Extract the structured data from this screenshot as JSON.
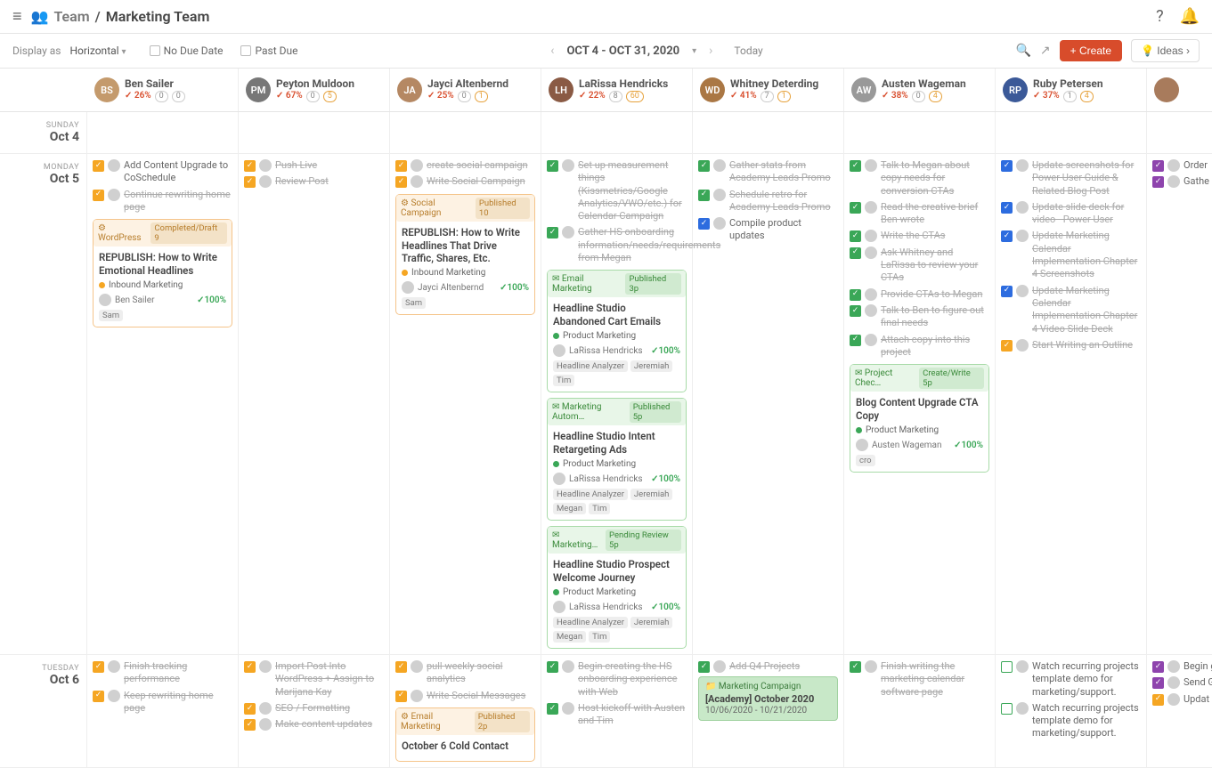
{
  "header": {
    "team_label": "Team",
    "breadcrumb_sep": "/",
    "page_title": "Marketing Team"
  },
  "toolbar": {
    "display_as_label": "Display as",
    "display_as_value": "Horizontal",
    "no_due_date": "No Due Date",
    "past_due": "Past Due",
    "date_range": "OCT 4 - OCT 31, 2020",
    "today": "Today",
    "create": "Create",
    "ideas": "Ideas"
  },
  "people": [
    {
      "name": "Ben Sailer",
      "percent": "26%",
      "n1": "0",
      "n2": "0",
      "initials": "BS",
      "avatar_bg": "#c49a6c"
    },
    {
      "name": "Peyton Muldoon",
      "percent": "67%",
      "n1": "0",
      "n2": "5",
      "initials": "PM",
      "avatar_bg": "#777"
    },
    {
      "name": "Jayci Altenbernd",
      "percent": "25%",
      "n1": "0",
      "n2": "1",
      "initials": "JA",
      "avatar_bg": "#b58863"
    },
    {
      "name": "LaRissa Hendricks",
      "percent": "22%",
      "n1": "8",
      "n2": "60",
      "initials": "LH",
      "avatar_bg": "#8a5a44"
    },
    {
      "name": "Whitney Deterding",
      "percent": "41%",
      "n1": "7",
      "n2": "1",
      "initials": "WD",
      "avatar_bg": "#aa7744"
    },
    {
      "name": "Austen Wageman",
      "percent": "38%",
      "n1": "0",
      "n2": "4",
      "initials": "AW",
      "avatar_bg": "#999"
    },
    {
      "name": "Ruby Petersen",
      "percent": "37%",
      "n1": "1",
      "n2": "4",
      "initials": "RP",
      "avatar_bg": "#3b5998"
    },
    {
      "name": "",
      "percent": "",
      "n1": "",
      "n2": "",
      "initials": "",
      "avatar_bg": "#a87b5c"
    }
  ],
  "days": [
    {
      "dow": "SUNDAY",
      "label": "Oct 4",
      "cells": [
        [],
        [],
        [],
        [],
        [],
        [],
        [],
        []
      ]
    },
    {
      "dow": "MONDAY",
      "label": "Oct 5",
      "cells": [
        [
          {
            "type": "task",
            "chk": "orange",
            "text": "Add Content Upgrade to CoSchedule"
          },
          {
            "type": "task",
            "chk": "orange",
            "text": "Continue rewriting home page",
            "strike": true
          },
          {
            "type": "card",
            "color": "orange",
            "head_left": "WordPress",
            "head_right": "Completed/Draft 9",
            "title": "REPUBLISH: How to Write Emotional Headlines",
            "sub": "Inbound Marketing",
            "subdot": "orange",
            "person": "Ben Sailer",
            "pct": "100%",
            "chips": [
              "Sam"
            ]
          }
        ],
        [
          {
            "type": "task",
            "chk": "orange",
            "text": "Push Live",
            "strike": true
          },
          {
            "type": "task",
            "chk": "orange",
            "text": "Review Post",
            "strike": true
          }
        ],
        [
          {
            "type": "task",
            "chk": "orange",
            "text": "create social campaign",
            "strike": true
          },
          {
            "type": "task",
            "chk": "orange",
            "text": "Write Social Campaign",
            "strike": true
          },
          {
            "type": "card",
            "color": "orange",
            "head_left": "Social Campaign",
            "head_right": "Published 10",
            "title": "REPUBLISH: How to Write Headlines That Drive Traffic, Shares, Etc.",
            "sub": "Inbound Marketing",
            "subdot": "orange",
            "person": "Jayci Altenbernd",
            "pct": "100%",
            "chips": [
              "Sam"
            ]
          }
        ],
        [
          {
            "type": "task",
            "chk": "green",
            "text": "Set up measurement things (Kissmetrics/Google Analytics/VWO/etc.) for Calendar Campaign",
            "strike": true
          },
          {
            "type": "task",
            "chk": "green",
            "text": "Gather HS onboarding information/needs/requirements from Megan",
            "strike": true
          },
          {
            "type": "card",
            "color": "green",
            "head_left": "Email Marketing",
            "head_right": "Published 3p",
            "title": "Headline Studio Abandoned Cart Emails",
            "sub": "Product Marketing",
            "subdot": "green",
            "person": "LaRissa Hendricks",
            "pct": "100%",
            "chips": [
              "Headline Analyzer",
              "Jeremiah",
              "Tim"
            ]
          },
          {
            "type": "card",
            "color": "green",
            "head_left": "Marketing Autom…",
            "head_right": "Published 5p",
            "title": "Headline Studio Intent Retargeting Ads",
            "sub": "Product Marketing",
            "subdot": "green",
            "person": "LaRissa Hendricks",
            "pct": "100%",
            "chips": [
              "Headline Analyzer",
              "Jeremiah",
              "Megan",
              "Tim"
            ]
          },
          {
            "type": "card",
            "color": "green",
            "head_left": "Marketing…",
            "head_right": "Pending Review 5p",
            "title": "Headline Studio Prospect Welcome Journey",
            "sub": "Product Marketing",
            "subdot": "green",
            "person": "LaRissa Hendricks",
            "pct": "100%",
            "chips": [
              "Headline Analyzer",
              "Jeremiah",
              "Megan",
              "Tim"
            ]
          }
        ],
        [
          {
            "type": "task",
            "chk": "green",
            "text": "Gather stats from Academy Leads Promo",
            "strike": true
          },
          {
            "type": "task",
            "chk": "green",
            "text": "Schedule retro for Academy Leads Promo",
            "strike": true
          },
          {
            "type": "task",
            "chk": "blue",
            "text": "Compile product updates"
          }
        ],
        [
          {
            "type": "task",
            "chk": "green",
            "text": "Talk to Megan about copy needs for conversion CTAs",
            "strike": true
          },
          {
            "type": "task",
            "chk": "green",
            "text": "Read the creative brief Ben wrote",
            "strike": true
          },
          {
            "type": "task",
            "chk": "green",
            "text": "Write the CTAs",
            "strike": true
          },
          {
            "type": "task",
            "chk": "green",
            "text": "Ask Whitney and LaRissa to review your CTAs",
            "strike": true
          },
          {
            "type": "task",
            "chk": "green",
            "text": "Provide CTAs to Megan",
            "strike": true
          },
          {
            "type": "task",
            "chk": "green",
            "text": "Talk to Ben to figure out final needs",
            "strike": true
          },
          {
            "type": "task",
            "chk": "green",
            "text": "Attach copy into this project",
            "strike": true
          },
          {
            "type": "card",
            "color": "green",
            "head_left": "Project Chec…",
            "head_right": "Create/Write 5p",
            "title": "Blog Content Upgrade CTA Copy",
            "sub": "Product Marketing",
            "subdot": "green",
            "person": "Austen Wageman",
            "pct": "100%",
            "chips": [
              "cro"
            ]
          }
        ],
        [
          {
            "type": "task",
            "chk": "blue",
            "text": "Update screenshots for Power User Guide & Related Blog Post",
            "strike": true
          },
          {
            "type": "task",
            "chk": "blue",
            "text": "Update slide deck for video - Power User",
            "strike": true
          },
          {
            "type": "task",
            "chk": "blue",
            "text": "Update Marketing Calendar Implementation Chapter 4 Screenshots",
            "strike": true
          },
          {
            "type": "task",
            "chk": "blue",
            "text": "Update Marketing Calendar Implementation Chapter 4 Video Slide Deck",
            "strike": true
          },
          {
            "type": "task",
            "chk": "orange",
            "text": "Start Writing an Outline",
            "strike": true
          }
        ],
        [
          {
            "type": "task",
            "chk": "purple",
            "text": "Order"
          },
          {
            "type": "task",
            "chk": "purple",
            "text": "Gathe points"
          }
        ]
      ]
    },
    {
      "dow": "TUESDAY",
      "label": "Oct 6",
      "cells": [
        [
          {
            "type": "task",
            "chk": "orange",
            "text": "Finish tracking performance",
            "strike": true
          },
          {
            "type": "task",
            "chk": "orange",
            "text": "Keep rewriting home page",
            "strike": true
          }
        ],
        [
          {
            "type": "task",
            "chk": "orange",
            "text": "Import Post Into WordPress + Assign to Marijana Kay",
            "strike": true
          },
          {
            "type": "task",
            "chk": "orange",
            "text": "SEO / Formatting",
            "strike": true
          },
          {
            "type": "task",
            "chk": "orange",
            "text": "Make content updates",
            "strike": true
          }
        ],
        [
          {
            "type": "task",
            "chk": "orange",
            "text": "pull weekly social analytics",
            "strike": true
          },
          {
            "type": "task",
            "chk": "orange",
            "text": "Write Social Messages",
            "strike": true
          },
          {
            "type": "card",
            "color": "orange",
            "head_left": "Email Marketing",
            "head_right": "Published 2p",
            "title": "October 6 Cold Contact",
            "sub": "",
            "subdot": "",
            "person": "",
            "pct": "",
            "chips": []
          }
        ],
        [
          {
            "type": "task",
            "chk": "green",
            "text": "Begin creating the HS onboarding experience with Web",
            "strike": true
          },
          {
            "type": "task",
            "chk": "green",
            "text": "Host kickoff with Austen and Tim",
            "strike": true
          }
        ],
        [
          {
            "type": "task",
            "chk": "green",
            "text": "Add Q4 Projects",
            "strike": true
          },
          {
            "type": "campaign",
            "head": "Marketing Campaign",
            "title": "[Academy] October 2020",
            "dates": "10/06/2020 - 10/21/2020"
          }
        ],
        [
          {
            "type": "task",
            "chk": "green",
            "text": "Finish writing the marketing calendar software page",
            "strike": true
          }
        ],
        [
          {
            "type": "task",
            "chk": "openbox",
            "text": "Watch recurring projects template demo for marketing/support."
          },
          {
            "type": "task",
            "chk": "openbox",
            "text": "Watch recurring projects template demo for marketing/support."
          }
        ],
        [
          {
            "type": "task",
            "chk": "purple",
            "text": "Begin graph"
          },
          {
            "type": "task",
            "chk": "purple",
            "text": "Send Garret"
          },
          {
            "type": "task",
            "chk": "orange",
            "text": "Updat"
          }
        ]
      ]
    }
  ]
}
